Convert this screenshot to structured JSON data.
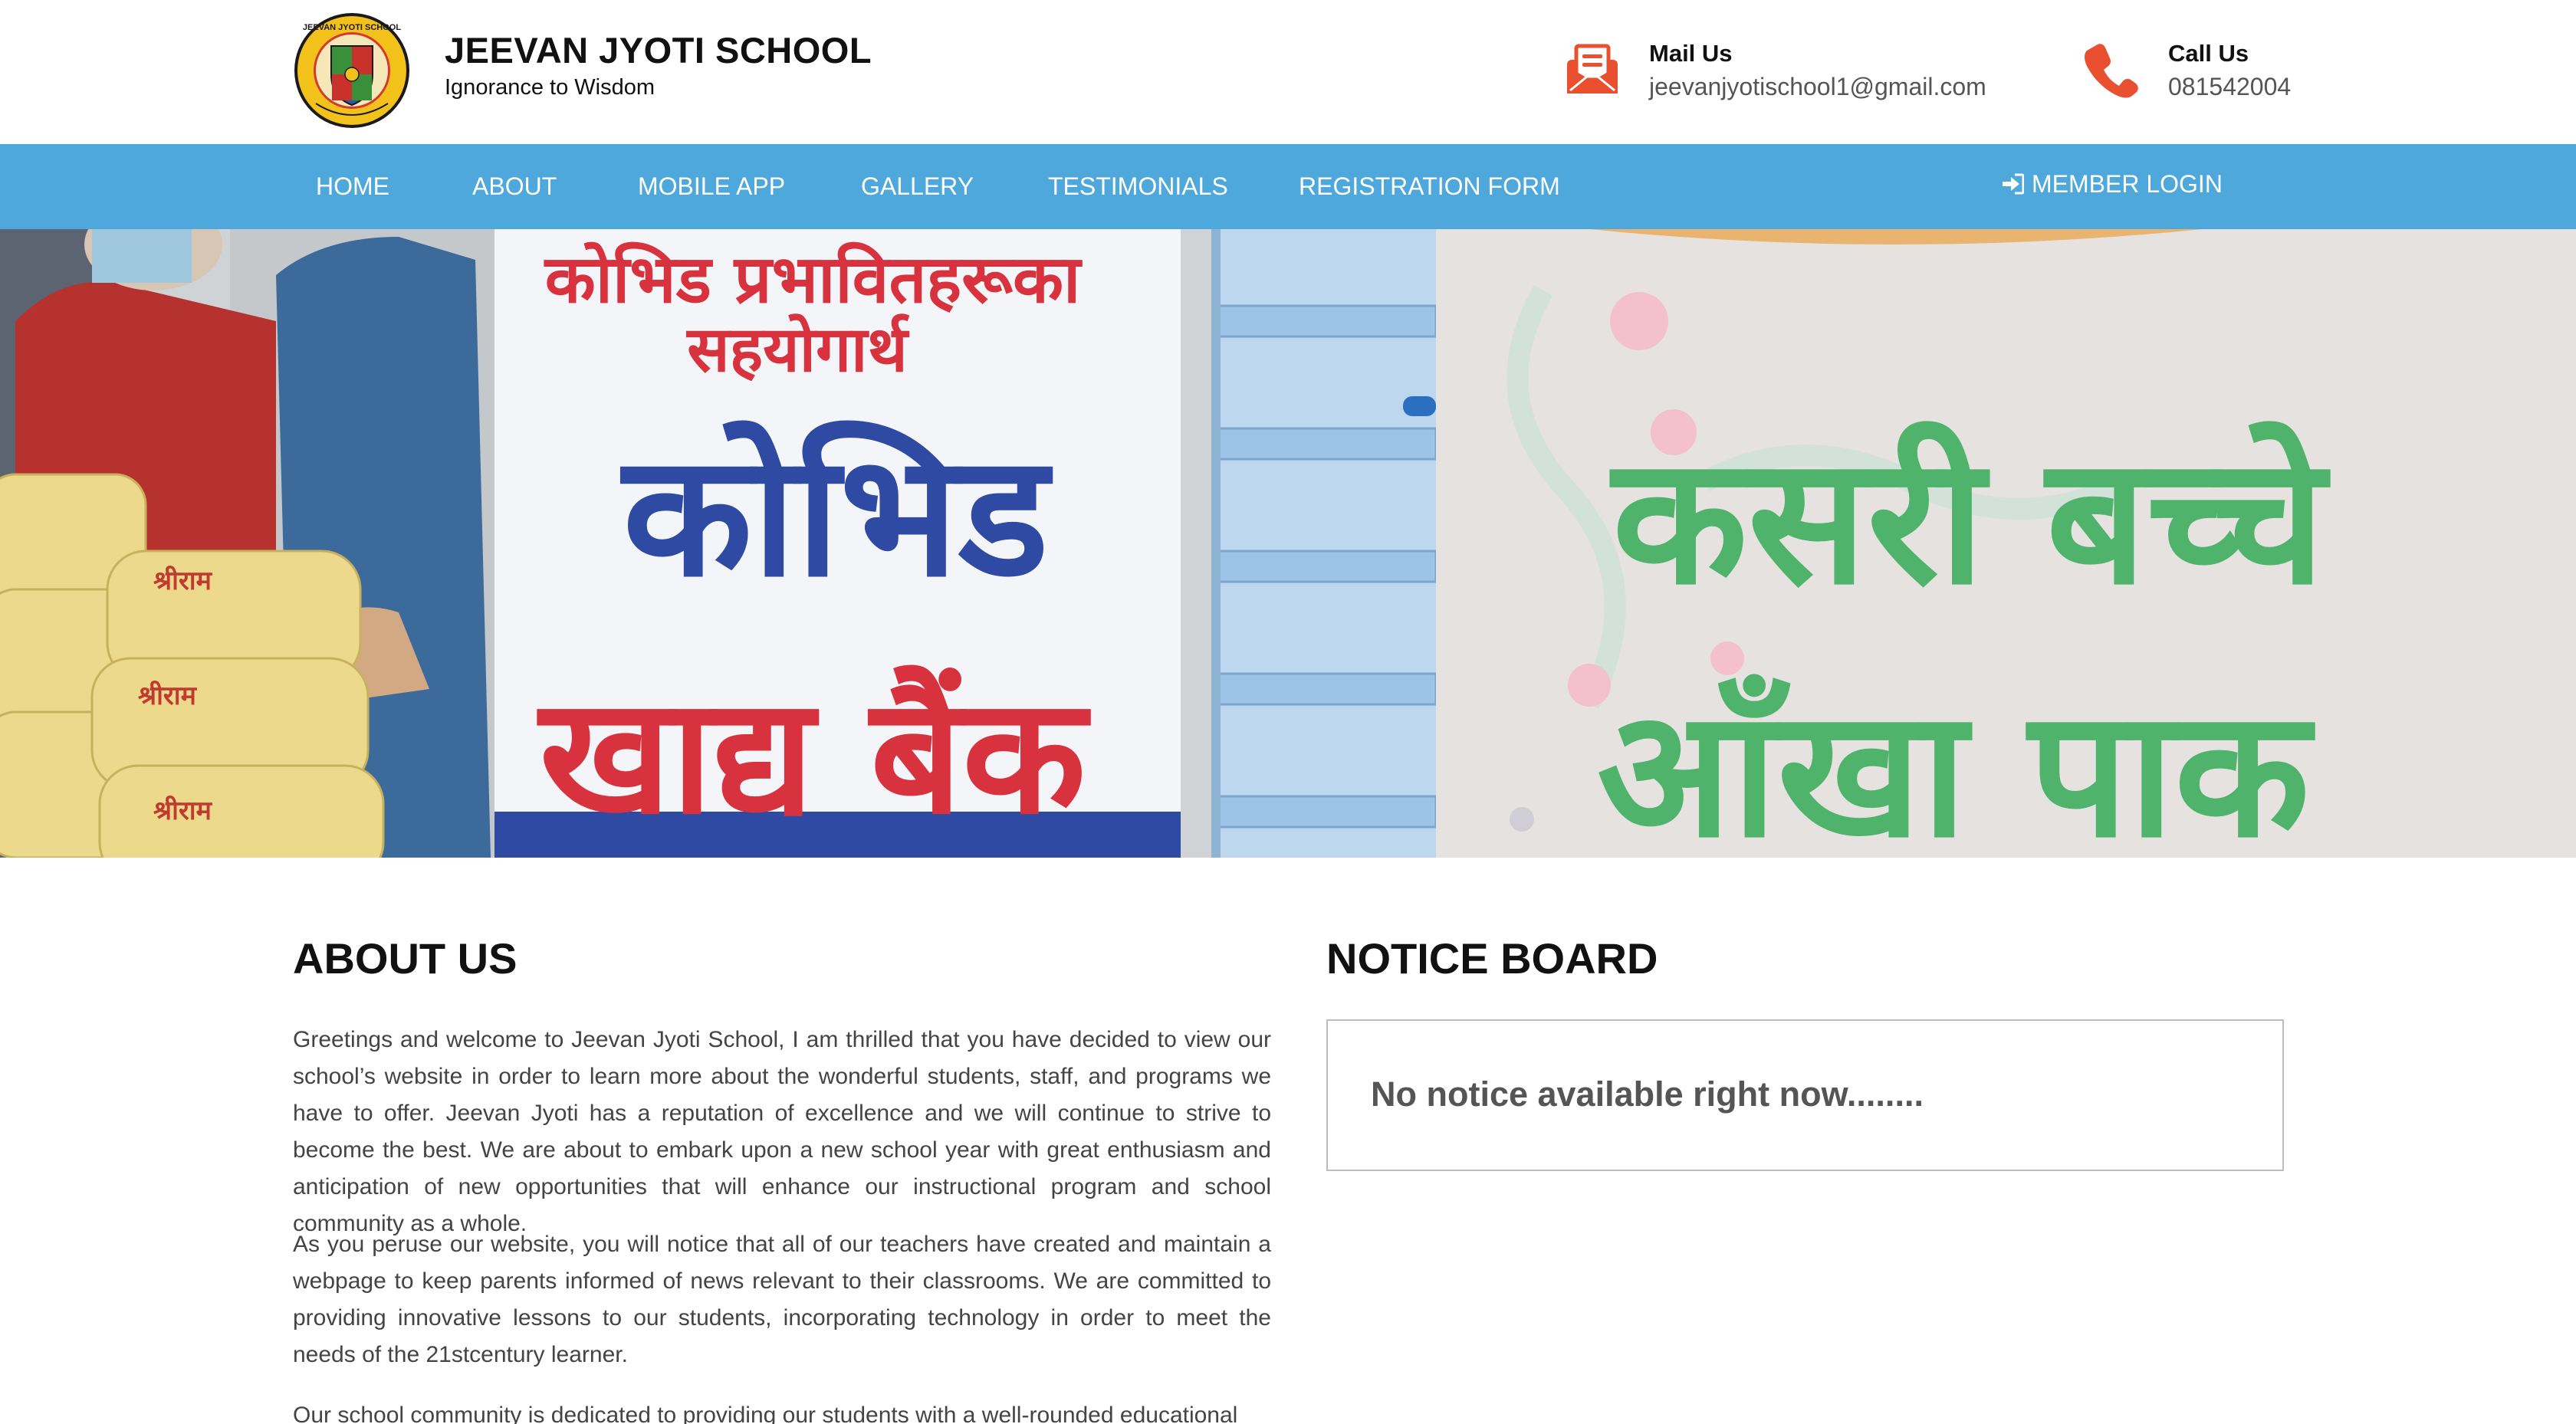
{
  "header": {
    "school_name": "JEEVAN JYOTI SCHOOL",
    "tagline": "Ignorance to Wisdom",
    "logo_ring_text": "JEEVAN JYOTI SCHOOL",
    "mail": {
      "title": "Mail Us",
      "value": "jeevanjyotischool1@gmail.com",
      "icon": "envelope-icon"
    },
    "call": {
      "title": "Call Us",
      "value": "081542004",
      "icon": "phone-icon"
    }
  },
  "nav": {
    "items": [
      {
        "label": "HOME"
      },
      {
        "label": "ABOUT"
      },
      {
        "label": "MOBILE APP"
      },
      {
        "label": "GALLERY"
      },
      {
        "label": "TESTIMONIALS"
      },
      {
        "label": "REGISTRATION FORM"
      }
    ],
    "login_label": "MEMBER LOGIN",
    "login_icon": "sign-in-icon"
  },
  "hero": {
    "left_banner": {
      "line1": "कोभिड प्रभावितहरूका",
      "line2": "सहयोगार्थ",
      "line3": "कोभिड",
      "line4": "खाद्य बैंक"
    },
    "right_banner": {
      "line1": "कसरी बच्चे",
      "line2": "आँखा पाक"
    }
  },
  "about": {
    "title": "ABOUT US",
    "paragraphs": [
      "Greetings and welcome to Jeevan Jyoti School, I am thrilled that you have decided to view our school’s website in order to learn more about the wonderful students, staff, and programs we have to offer. Jeevan Jyoti has a reputation of excellence and we will continue to strive to become the best. We are about to embark upon a new school year with great enthusiasm and anticipation of new opportunities that will enhance our instructional program and school community as a whole.",
      "As you peruse our website, you will notice that all of our teachers have created and maintain a webpage to keep parents informed of news relevant to their classrooms. We are committed to providing innovative lessons to our students, incorporating technology in order to meet the needs of the 21stcentury learner.",
      "Our school community is dedicated to providing our students with a well-rounded educational"
    ]
  },
  "notice_board": {
    "title": "NOTICE BOARD",
    "message": "No notice available right now........"
  },
  "colors": {
    "nav_bg": "#4ea8dc",
    "accent_red": "#e8502f",
    "heading": "#111111",
    "body_text": "#444444"
  }
}
